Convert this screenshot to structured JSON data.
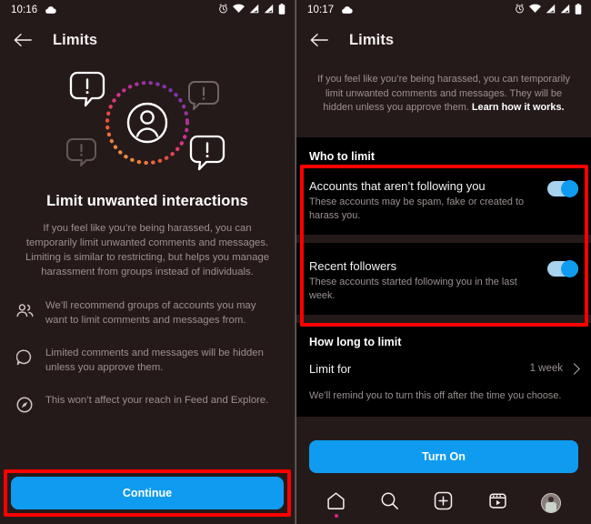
{
  "colors": {
    "page_bg": "#251a1a",
    "section_bg": "#000000",
    "accent_blue": "#0f9bf0",
    "annotation_red": "#ff0000",
    "muted_text": "#9c9090",
    "badge_pink": "#e0218a"
  },
  "left": {
    "statusbar": {
      "time": "10:16",
      "icons": [
        "cloud-icon",
        "alarm-icon",
        "wifi-icon",
        "signal-icon",
        "signal-icon-2",
        "battery-icon"
      ]
    },
    "appbar": {
      "back": "back-arrow-icon",
      "title": "Limits"
    },
    "illustration": {
      "name": "limit-interactions-illustration",
      "avatar": "person-avatar-icon",
      "ring": "dotted-gradient-ring",
      "bubbles": [
        "alert-bubble-bright-top-left",
        "alert-bubble-dim-right",
        "alert-bubble-dim-left",
        "alert-bubble-bright-bottom-right"
      ]
    },
    "hero": {
      "title": "Limit unwanted interactions",
      "body": "If you feel like you’re being harassed, you can temporarily limit unwanted comments and messages. Limiting is similar to restricting, but helps you manage harassment from groups instead of individuals."
    },
    "features": [
      {
        "icon": "people-icon",
        "text": "We’ll recommend groups of accounts you may want to limit comments and messages from."
      },
      {
        "icon": "comment-icon",
        "text": "Limited comments and messages will be hidden unless you approve them."
      },
      {
        "icon": "compass-icon",
        "text": "This won’t affect your reach in Feed and Explore."
      }
    ],
    "continue_button": {
      "label": "Continue",
      "highlighted": true
    }
  },
  "right": {
    "statusbar": {
      "time": "10:17",
      "icons": [
        "cloud-icon",
        "alarm-icon",
        "wifi-icon",
        "signal-icon",
        "signal-icon-2",
        "battery-icon"
      ]
    },
    "appbar": {
      "back": "back-arrow-icon",
      "title": "Limits"
    },
    "intro": {
      "text": "If you feel like you’re being harassed, you can temporarily limit unwanted comments and messages. They will be hidden unless you approve them. ",
      "link": "Learn how it works."
    },
    "who_to_limit": {
      "title": "Who to limit",
      "highlighted": true,
      "rows": [
        {
          "title": "Accounts that aren’t following you",
          "sub": "These accounts may be spam, fake or created to harass you.",
          "toggle_on": true
        },
        {
          "title": "Recent followers",
          "sub": "These accounts started following you in the last week.",
          "toggle_on": true
        }
      ]
    },
    "how_long": {
      "title": "How long to limit",
      "row": {
        "label": "Limit for",
        "value": "1 week",
        "chevron": "chevron-right-icon"
      },
      "note": "We’ll remind you to turn this off after the time you choose."
    },
    "turn_on_button": {
      "label": "Turn On"
    },
    "bottom_nav": [
      {
        "name": "nav-home",
        "icon": "home-icon",
        "active": true
      },
      {
        "name": "nav-search",
        "icon": "search-icon",
        "active": false
      },
      {
        "name": "nav-create",
        "icon": "plus-square-icon",
        "active": false
      },
      {
        "name": "nav-reels",
        "icon": "reels-icon",
        "active": false
      },
      {
        "name": "nav-profile",
        "icon": "profile-avatar-icon",
        "active": false
      }
    ]
  }
}
